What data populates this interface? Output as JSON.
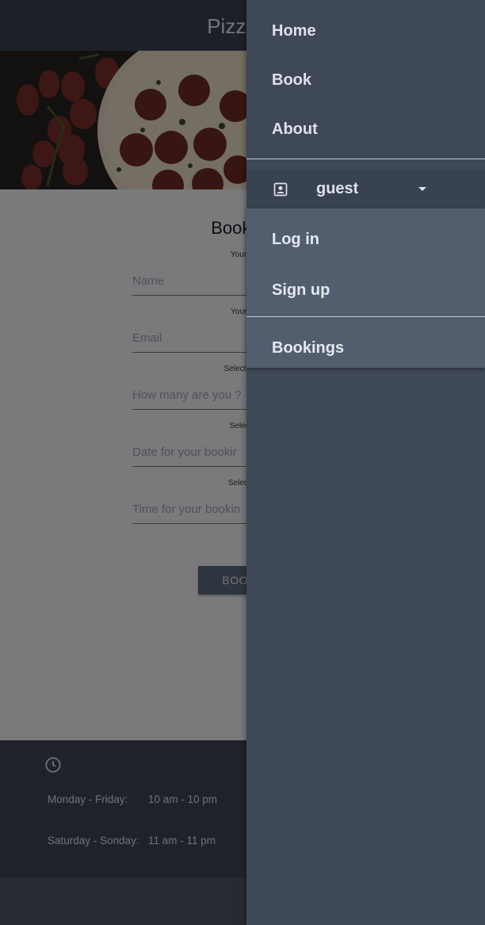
{
  "header": {
    "brand": "Pizza H"
  },
  "booking": {
    "title": "Booking",
    "fields": [
      {
        "label": "Your N",
        "placeholder": "Name"
      },
      {
        "label": "Your E",
        "placeholder": "Email"
      },
      {
        "label": "Select hov",
        "placeholder": "How many are you ?"
      },
      {
        "label": "Select l",
        "placeholder": "Date for your bookir"
      },
      {
        "label": "Select T",
        "placeholder": "Time for your bookin"
      }
    ],
    "submit_label": "BOOK I"
  },
  "footer": {
    "icon": "clock-icon",
    "hours": [
      {
        "days": "Monday - Friday:",
        "time": "10 am - 10 pm"
      },
      {
        "days": "Saturday - Sonday:",
        "time": "11 am - 11 pm"
      }
    ]
  },
  "sidenav": {
    "items": [
      {
        "label": "Home"
      },
      {
        "label": "Book"
      },
      {
        "label": "About"
      }
    ],
    "account": {
      "icon": "account-box-icon",
      "name": "guest"
    },
    "account_menu": [
      {
        "label": "Log in"
      },
      {
        "label": "Sign up"
      },
      {
        "label": "Bookings"
      }
    ]
  },
  "colors": {
    "topbar": "#3a4150",
    "sidenav": "#3e4856",
    "dropdown": "#525e6e",
    "button": "#5f6b7d"
  }
}
